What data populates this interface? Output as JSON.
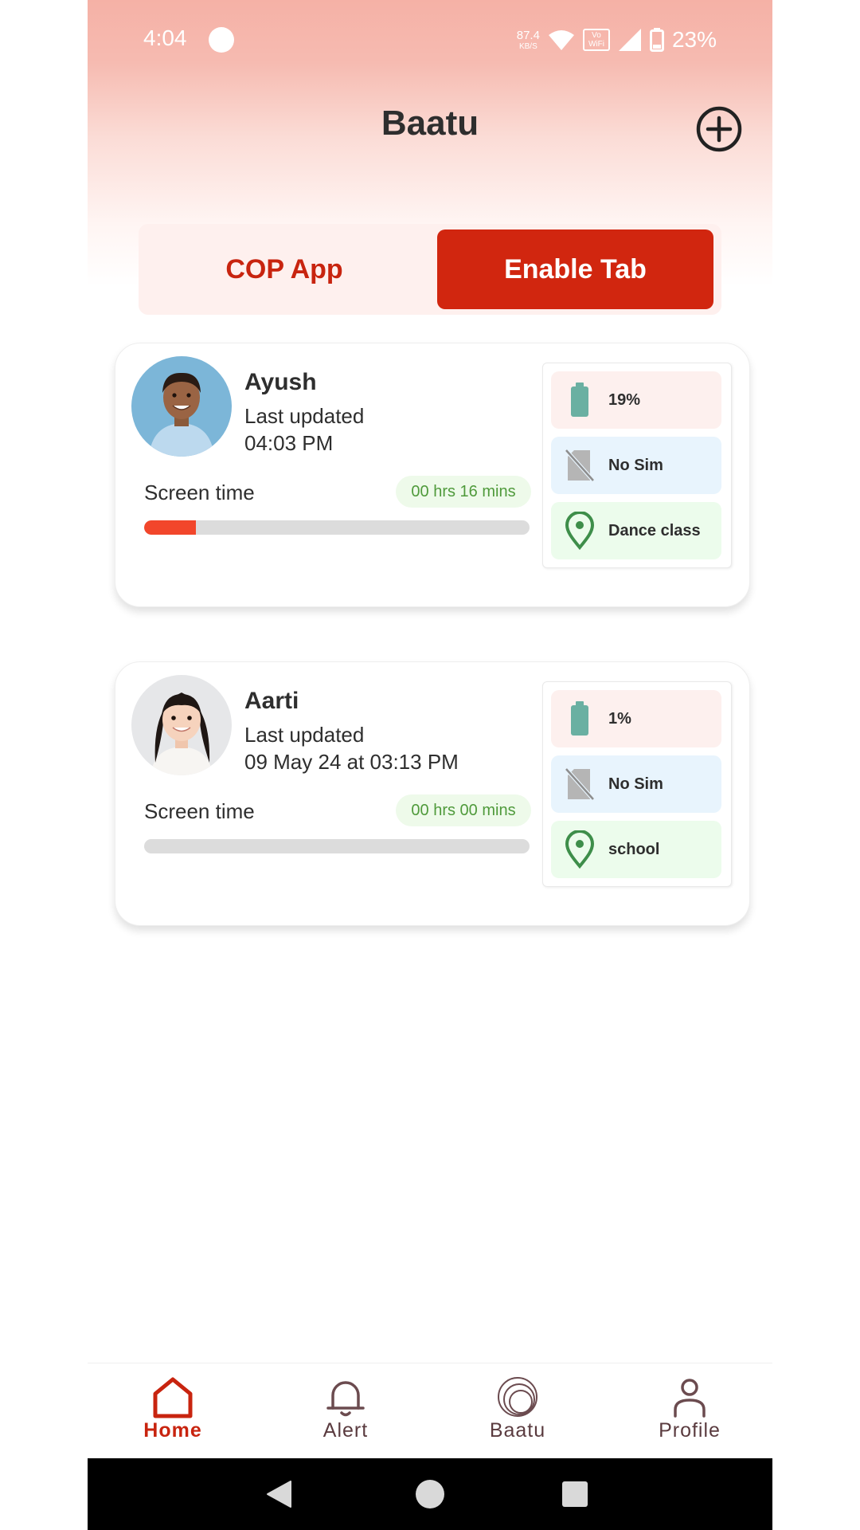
{
  "status_bar": {
    "time": "4:04",
    "speed_value": "87.4",
    "speed_unit": "KB/S",
    "volte_top": "Vo",
    "volte_bottom": "WiFi",
    "battery": "23%"
  },
  "header": {
    "title": "Baatu",
    "add_icon": "plus-circle-icon"
  },
  "toggle": {
    "options": [
      "COP App",
      "Enable Tab"
    ],
    "selected": "Enable Tab"
  },
  "children": [
    {
      "name": "Ayush",
      "last_updated_label": "Last updated",
      "last_updated_value": "04:03 PM",
      "screen_time_label": "Screen time",
      "screen_time_value": "00 hrs 16 mins",
      "screen_time_progress": 0.135,
      "battery": "19%",
      "sim": "No Sim",
      "location": "Dance class"
    },
    {
      "name": "Aarti",
      "last_updated_label": "Last updated",
      "last_updated_value": "09 May 24 at 03:13 PM",
      "screen_time_label": "Screen time",
      "screen_time_value": "00 hrs 00 mins",
      "screen_time_progress": 0,
      "battery": "1%",
      "sim": "No Sim",
      "location": "school"
    }
  ],
  "bottom_nav": {
    "items": [
      {
        "label": "Home",
        "icon": "home-icon",
        "active": true
      },
      {
        "label": "Alert",
        "icon": "bell-icon",
        "active": false
      },
      {
        "label": "Baatu",
        "icon": "baatu-rings-icon",
        "active": false
      },
      {
        "label": "Profile",
        "icon": "person-icon",
        "active": false
      }
    ]
  },
  "colors": {
    "accent": "#d1260f",
    "header_gradient_top": "#f5b1a6",
    "progress_fill": "#f2462b",
    "screen_time_text": "#4f9a3b",
    "battery_chip": "#fdf0ee",
    "sim_chip": "#e8f4fd",
    "location_chip": "#ecfcec"
  }
}
